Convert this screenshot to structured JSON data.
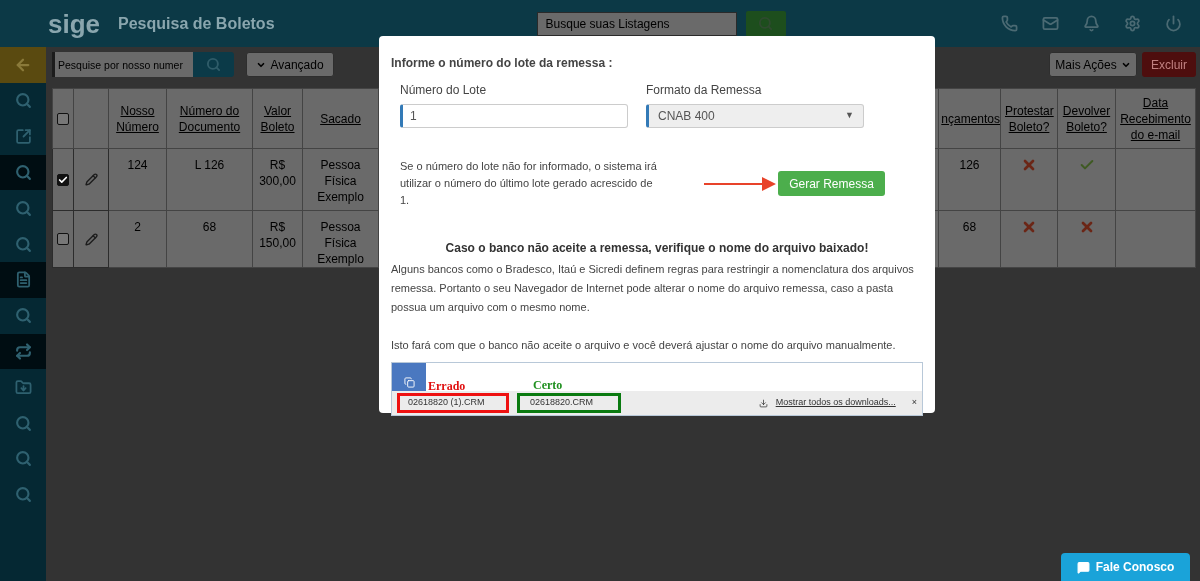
{
  "header": {
    "logo": "sige",
    "title": "Pesquisa de Boletos",
    "search": {
      "placeholder": "Busque suas Listagens"
    }
  },
  "sidebar": {
    "items": [
      {
        "kind": "back",
        "selected": false
      },
      {
        "kind": "search",
        "selected": false
      },
      {
        "kind": "share",
        "selected": false
      },
      {
        "kind": "search",
        "selected": true
      },
      {
        "kind": "search",
        "selected": false
      },
      {
        "kind": "search",
        "selected": false
      },
      {
        "kind": "list",
        "selected": true
      },
      {
        "kind": "search",
        "selected": false
      },
      {
        "kind": "repeat",
        "selected": true
      },
      {
        "kind": "folder",
        "selected": false
      },
      {
        "kind": "search",
        "selected": false
      },
      {
        "kind": "search",
        "selected": false
      },
      {
        "kind": "search",
        "selected": false
      }
    ]
  },
  "toolbar": {
    "search": {
      "placeholder": "Pesquise por nosso numer"
    },
    "advanced": "Avançado",
    "more_actions": "Mais Ações",
    "delete": "Excluir"
  },
  "table": {
    "columns": [
      "Nosso Número",
      "Número do Documento",
      "Valor Boleto",
      "Sacado",
      "nçamentos",
      "Protestar Boleto?",
      "Devolver Boleto?",
      "Data Recebimento do e-mail"
    ],
    "header_checked": false,
    "rows": [
      {
        "checked": true,
        "nosso_numero": "124",
        "documento": "L 126",
        "valor": "R$ 300,00",
        "sacado": "Pessoa Física Exemplo",
        "lancamentos": "126",
        "protestar": false,
        "devolver": true
      },
      {
        "checked": false,
        "nosso_numero": "2",
        "documento": "68",
        "valor": "R$ 150,00",
        "sacado": "Pessoa Física Exemplo",
        "lancamentos": "68",
        "protestar": false,
        "devolver": false
      }
    ]
  },
  "modal": {
    "heading": "Informe o número do lote da remessa :",
    "lote_label": "Número do Lote",
    "lote_value": "1",
    "formato_label": "Formato da Remessa",
    "formato_value": "CNAB 400",
    "formato_caret": "▼",
    "note": "Se o número do lote não for informado, o sistema irá utilizar o número do último lote gerado acrescido de 1.",
    "button": "Gerar Remessa",
    "warning": "Caso o banco não aceite a remessa, verifique o nome do arquivo baixado!",
    "paragraphs": [
      "Alguns bancos como o Bradesco, Itaú e Sicredi definem regras para restringir a nomenclatura dos arquivos remessa. Portanto o seu Navegador de Internet pode alterar o nome do arquivo remessa, caso a pasta possua um arquivo com o mesmo nome.",
      "Isto fará com que o banco não aceite o arquivo e você deverá ajustar o nome do arquivo manualmente."
    ],
    "example": {
      "wrong_label": "Errado",
      "right_label": "Certo",
      "wrong_file": "02618820 (1).CRM",
      "right_file": "02618820.CRM",
      "show_all": "Mostrar todos os downloads...",
      "close": "×"
    }
  },
  "chat_button": "Fale Conosco"
}
